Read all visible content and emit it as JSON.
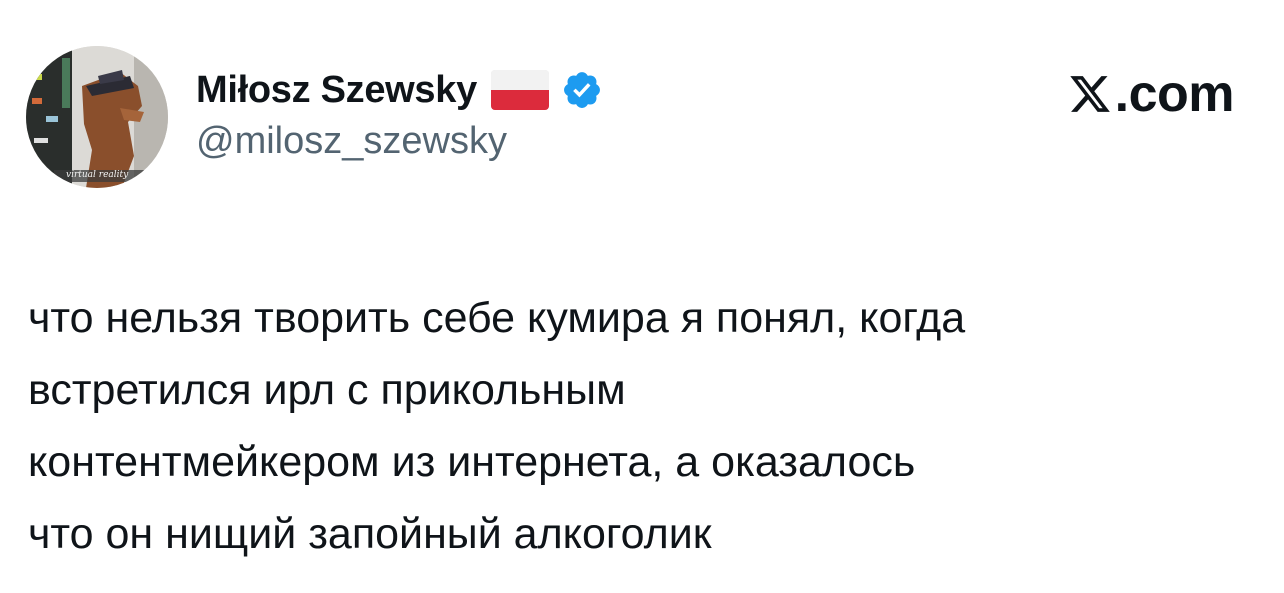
{
  "author": {
    "display_name": "Miłosz Szewsky",
    "handle": "@milosz_szewsky",
    "flag_icon": "poland-flag-icon",
    "verified_icon": "verified-badge-icon",
    "verified_color": "#1d9bf0",
    "avatar_caption": "virtual reality"
  },
  "brand": {
    "label": ".com",
    "icon": "x-logo-icon"
  },
  "tweet": {
    "lines": [
      "что нельзя творить себе кумира я понял, когда",
      "встретился ирл с прикольным",
      "контентмейкером из интернета, а оказалось",
      "что он нищий запойный алкоголик"
    ]
  },
  "colors": {
    "text": "#0f1419",
    "secondary_text": "#536471",
    "background": "#ffffff"
  }
}
